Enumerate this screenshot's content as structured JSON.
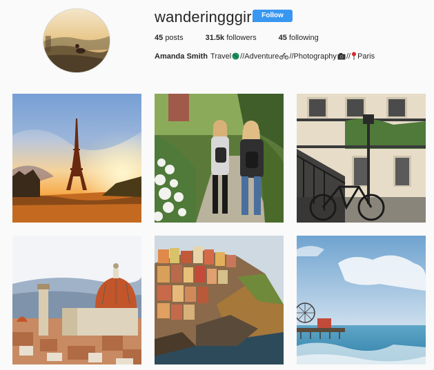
{
  "profile": {
    "username": "wanderingggirl",
    "follow_label": "Follow",
    "posts_count": "45",
    "posts_label": "posts",
    "followers_count": "31.5k",
    "followers_label": "followers",
    "following_count": "45",
    "following_label": "following",
    "full_name": "Amanda Smith",
    "bio": {
      "part1": "Travel",
      "part2": "//Adventure",
      "part3": "//Photography",
      "part4": "//",
      "part5": "Paris"
    },
    "bio_icons": [
      "globe-icon",
      "bicycle-icon",
      "camera-icon",
      "round-pushpin-icon"
    ]
  },
  "colors": {
    "follow_button": "#3897f0",
    "background": "#fafafa",
    "text": "#262626"
  },
  "posts": [
    {
      "subject": "eiffel-tower-sunset"
    },
    {
      "subject": "two-girls-walking-path"
    },
    {
      "subject": "parisian-building-bicycle"
    },
    {
      "subject": "florence-cathedral-skyline"
    },
    {
      "subject": "cinque-terre-cliff-village"
    },
    {
      "subject": "beach-pier-ferris-wheel"
    }
  ]
}
